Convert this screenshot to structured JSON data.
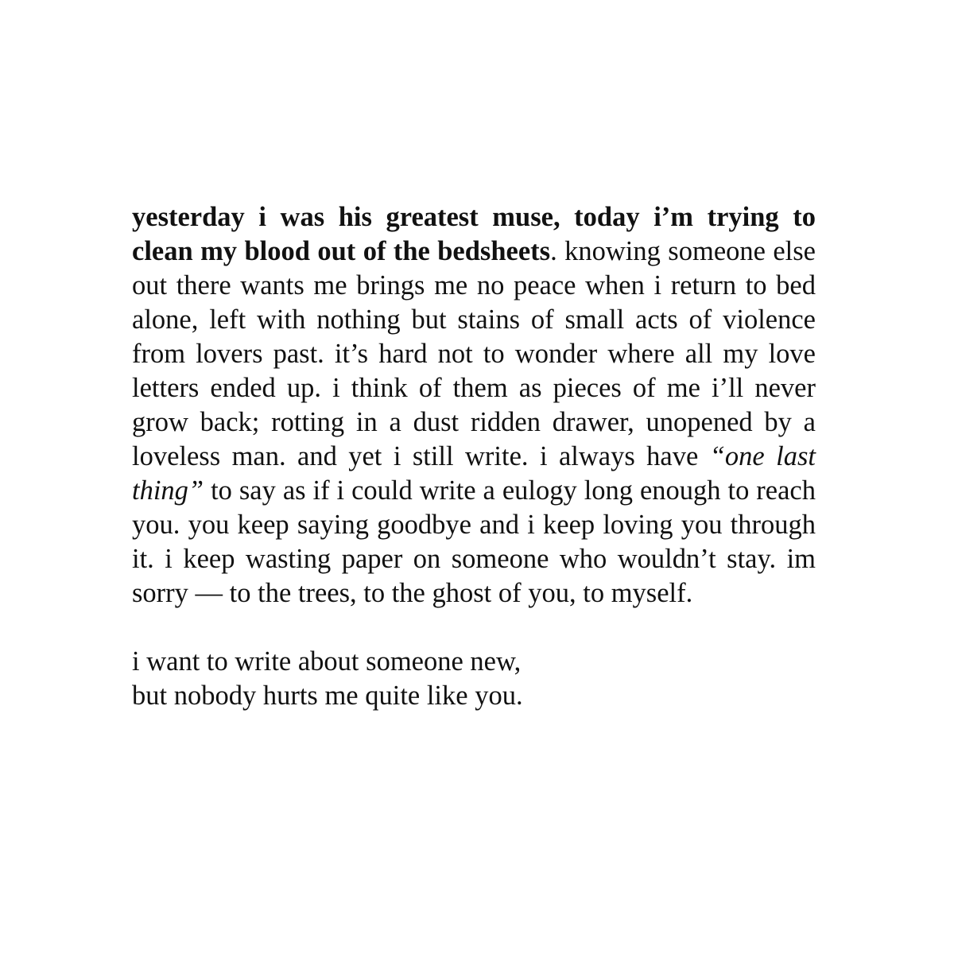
{
  "poem": {
    "bold_opening": "yesterday i was his greatest muse, today i’m trying to clean my blood out of the bedsheets",
    "segment_1": ". knowing someone else out there wants me brings me no peace when i return to bed alone, left with nothing but stains of small acts of violence from lovers past. it’s hard not to wonder where all my love letters ended up. i think of them as pieces of me i’ll never grow back; rotting in a dust ridden drawer, unopened by a loveless man. and yet i still write. i always have ",
    "italic_phrase": "“one last thing”",
    "segment_2": " to say as if i could write a eulogy long enough to reach you. you keep saying goodbye and i keep loving you through it. i keep wasting paper on someone who wouldn’t stay. im sorry — to the trees, to the ghost of you, to myself.",
    "closing_line_1": "i want to write about someone new,",
    "closing_line_2": "but nobody hurts me quite like you."
  }
}
